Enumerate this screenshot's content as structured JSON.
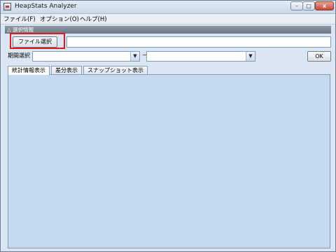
{
  "window": {
    "title": "HeapStats Analyzer",
    "minimize": "–",
    "maximize": "□",
    "close": "x"
  },
  "menu": {
    "items": [
      "ファイル(F)",
      "オプション(O)",
      "ヘルプ(H)"
    ]
  },
  "selection": {
    "header": "△ 選択情報",
    "file_button": "ファイル選択",
    "file_path": "",
    "period_label": "期間選択",
    "range_separator": "~",
    "start_value": "",
    "end_value": "",
    "ok_button": "OK"
  },
  "tabs": [
    "統計情報表示",
    "差分表示",
    "スナップショット表示"
  ],
  "active_tab": "統計情報表示",
  "colors": {
    "highlight": "#e01919",
    "panel": "#c5daf1"
  }
}
